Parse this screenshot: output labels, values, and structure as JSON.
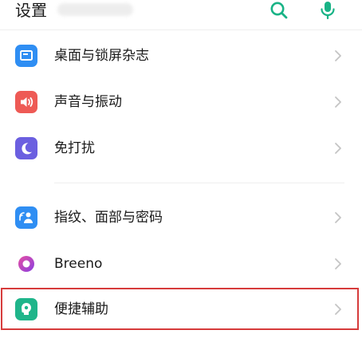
{
  "header": {
    "title": "设置",
    "icons": [
      "search-icon",
      "mic-icon"
    ],
    "accent": "#19b386"
  },
  "sections": [
    {
      "items": [
        {
          "label": "桌面与锁屏杂志",
          "icon": "wallpaper-icon",
          "color": "#2f8ef3"
        },
        {
          "label": "声音与振动",
          "icon": "speaker-icon",
          "color": "#ee5a55"
        },
        {
          "label": "免打扰",
          "icon": "moon-icon",
          "color": "#6b5fe0"
        }
      ]
    },
    {
      "items": [
        {
          "label": "指纹、面部与密码",
          "icon": "fingerprint-icon",
          "color": "#2f8ef3"
        },
        {
          "label": "Breeno",
          "icon": "breeno-icon",
          "color": "#b548d8"
        },
        {
          "label": "便捷辅助",
          "icon": "assist-icon",
          "color": "#1fb58a",
          "highlighted": true
        }
      ]
    }
  ],
  "highlight_color": "#d63b3b"
}
